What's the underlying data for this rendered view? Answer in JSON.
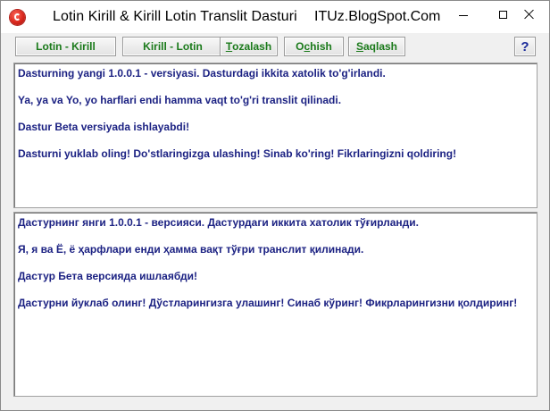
{
  "window": {
    "title": "Lotin Kirill & Kirill Lotin Translit Dasturi",
    "site": "ITUz.BlogSpot.Com",
    "app_icon": "red-circle-logo-icon",
    "caption_buttons": [
      "minimize-icon",
      "maximize-icon",
      "close-icon"
    ]
  },
  "toolbar": {
    "buttons": [
      {
        "label": "Lotin - Kirill"
      },
      {
        "label": "Kirill - Lotin"
      },
      {
        "label_accel": "T",
        "label_rest": "ozalash"
      },
      {
        "label_pre": "O",
        "label_accel": "c",
        "label_rest": "hish"
      },
      {
        "label_accel": "S",
        "label_rest": "aqlash"
      }
    ],
    "help_label": "?"
  },
  "latin_text": [
    "Dasturning yangi 1.0.0.1 - versiyasi. Dasturdagi ikkita xatolik to'g'irlandi.",
    "Ya, ya va Yo, yo harflari endi hamma vaqt to'g'ri translit qilinadi.",
    "Dastur Beta versiyada ishlayabdi!",
    "Dasturni yuklab oling! Do'stlaringizga ulashing! Sinab ko'ring! Fikrlaringizni qoldiring!"
  ],
  "cyrillic_text": [
    "Дастурнинг янги 1.0.0.1 - версияси. Дастурдаги иккита хатолик тўғирланди.",
    "Я, я ва Ё, ё ҳарфлари енди ҳамма вақт тўғри транслит қилинади.",
    "Дастур Бета версияда ишлаябди!",
    "Дастурни йуклаб олинг! Дўстларингизга улашинг! Синаб кўринг! Фикрларингизни қолдиринг!"
  ],
  "colors": {
    "text": "#1c2283",
    "button_text": "#1a7a1a",
    "help_text": "#1a2a9a"
  }
}
